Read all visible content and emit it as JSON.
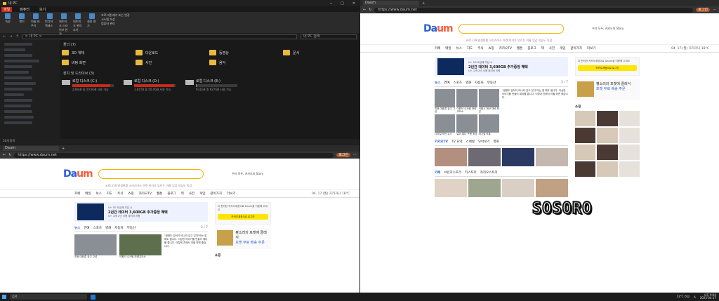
{
  "explorer": {
    "title": "내 PC",
    "ribbon_tabs": [
      "파일",
      "컴퓨터",
      "보기"
    ],
    "ribbon_buttons": [
      "속성",
      "열기",
      "이름 바꾸기",
      "미디어 액세스",
      "네트워크 드라이브 연결",
      "네트워크 위치 추가",
      "설정 열기"
    ],
    "ribbon_list": [
      "프로그램 제거 또는 변경",
      "시스템 속성",
      "컴퓨터 관리"
    ],
    "ribbon_groups": [
      "위치",
      "네트워크",
      "시스템"
    ],
    "address": "> 내 PC >",
    "search_placeholder": "내 PC 검색",
    "folders_header": "폴더 (7)",
    "folders": [
      "3D 개체",
      "다운로드",
      "동영상",
      "문서",
      "바탕 화면",
      "사진",
      "음악"
    ],
    "drives_header": "장치 및 드라이브 (3)",
    "drives": [
      {
        "name": "로컬 디스크 (C:)",
        "free": "238GB 중 20.9GB 사용 가능",
        "used": 0.91,
        "color": "#c42b1c"
      },
      {
        "name": "로컬 디스크 (D:)",
        "free": "1.81TB 중 50.4GB 사용 가능",
        "used": 0.97,
        "color": "#c42b1c"
      },
      {
        "name": "로컬 디스크 (E:)",
        "free": "931GB 중 927GB 사용 가능",
        "used": 0.01,
        "color": "#4aa3ff"
      }
    ],
    "status": "10개 항목"
  },
  "browser_bl": {
    "tab": "Daum",
    "url": "https://www.daum.net",
    "login": "로그인",
    "search_links": "코로나19 발생현황  크리스마스 마켓  까치가 부르는 이름  입김  지능도 독감"
  },
  "browser_r": {
    "tab": "Daum",
    "url": "https://www.daum.net",
    "login": "로그인",
    "search_links": "코로나19 발생현황  크리스마스 마켓  까치가 부르는 이름  입김  지능도 독감"
  },
  "daum": {
    "logo_main": "Da",
    "logo_accent": "um",
    "story": "우리 모두, 카카오의 Story",
    "gnb": [
      "카페",
      "메일",
      "뉴스",
      "지도",
      "주식",
      "쇼핑",
      "카카오TV",
      "웹툰",
      "블로그",
      "책",
      "사전",
      "게임",
      "같이가치",
      "더보기"
    ],
    "weather": "04. 17.(월)  흐리거나  18°C",
    "ad_line1": "U+ 5G 요금제 가입 시",
    "ad_line2": "2년간 데이터 3,600GB 추가증정 혜택",
    "ad_line3": "U+ 고객 2년 사용 데이터 지원",
    "news_tabs": [
      "뉴스",
      "연예",
      "스포츠",
      "영화",
      "자동차",
      "부동산"
    ],
    "news_page": "3 / 7",
    "captions": [
      "친윤 대표론 놓고 고성",
      "이원석 수사팀 안양교도소",
      "서울시 재산 대비 확인",
      "디지털 보안 뉴스",
      "날씨 맑다 구름 조금",
      "대기질 보통"
    ],
    "news_text": "\"생명도 입덕이 아니라 갖고 있다\"라는 말 해도 됩니다. 이상한 이야기를 만들어 재미를 줍니다. 이렇게 친해서 어필 하면 좋습니다.",
    "login_text": "더 편리한 카카오계정으로 Daum을 이용해 주세요",
    "kakao_login": "카카오계정으로 로그인",
    "ad2_title": "평소러의 포켓에 클래식",
    "ad2_sub": "포켓 무료 배송 주문",
    "shop_title": "쇼핑",
    "tv_tabs": [
      "카카오TV",
      "TV 요약",
      "스페셜",
      "모아보기",
      "영화"
    ],
    "story_tabs": [
      "카페",
      "브런치스토리",
      "티스토리",
      "카카오스토리"
    ]
  },
  "watermark": "SOSORO",
  "taskbar": {
    "search": "검색",
    "weather": "13°C 흐림",
    "time": "오후 9:04",
    "date": "2023-04-17"
  }
}
